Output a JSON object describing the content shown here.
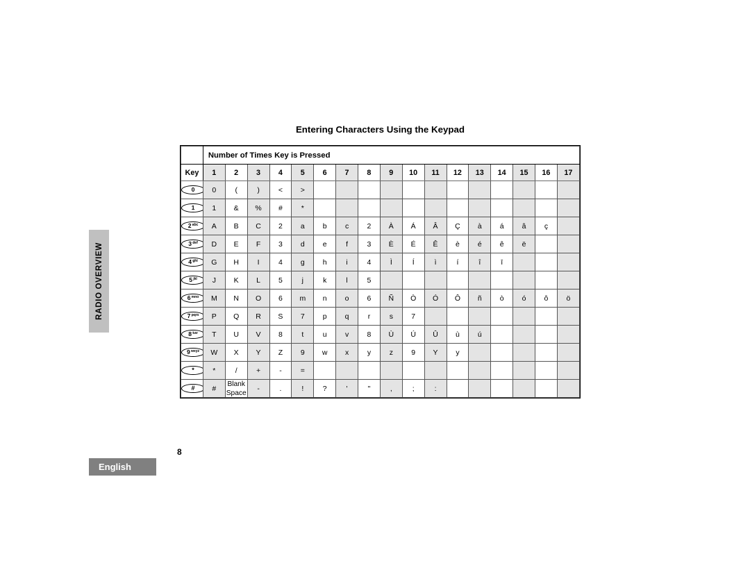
{
  "side_tab": {
    "label": "RADIO OVERVIEW"
  },
  "footer": {
    "language": "English",
    "page_number": "8"
  },
  "title": "Entering Characters Using the Keypad",
  "table": {
    "banner_label": "Number of Times Key is Pressed",
    "key_column_header": "Key",
    "press_headers": [
      "1",
      "2",
      "3",
      "4",
      "5",
      "6",
      "7",
      "8",
      "9",
      "10",
      "11",
      "12",
      "13",
      "14",
      "15",
      "16",
      "17"
    ],
    "rows": [
      {
        "key": {
          "number": "0",
          "letters": "",
          "type": "digit"
        },
        "cells": [
          "0",
          "(",
          ")",
          "<",
          ">",
          "",
          "",
          "",
          "",
          "",
          "",
          "",
          "",
          "",
          "",
          "",
          ""
        ]
      },
      {
        "key": {
          "number": "1",
          "letters": "",
          "type": "digit"
        },
        "cells": [
          "1",
          "&",
          "%",
          "#",
          "*",
          "",
          "",
          "",
          "",
          "",
          "",
          "",
          "",
          "",
          "",
          "",
          ""
        ]
      },
      {
        "key": {
          "number": "2",
          "letters": "abc",
          "type": "digit"
        },
        "cells": [
          "A",
          "B",
          "C",
          "2",
          "a",
          "b",
          "c",
          "2",
          "À",
          "Á",
          "Â",
          "Ç",
          "à",
          "á",
          "â",
          "ç",
          ""
        ]
      },
      {
        "key": {
          "number": "3",
          "letters": "def",
          "type": "digit"
        },
        "cells": [
          "D",
          "E",
          "F",
          "3",
          "d",
          "e",
          "f",
          "3",
          "È",
          "É",
          "Ê",
          "è",
          "é",
          "ê",
          "ë",
          "",
          ""
        ]
      },
      {
        "key": {
          "number": "4",
          "letters": "ghi",
          "type": "digit"
        },
        "cells": [
          "G",
          "H",
          "I",
          "4",
          "g",
          "h",
          "i",
          "4",
          "Ì",
          "Í",
          "ì",
          "í",
          "î",
          "ī",
          "",
          "",
          ""
        ]
      },
      {
        "key": {
          "number": "5",
          "letters": "jkl",
          "type": "digit"
        },
        "cells": [
          "J",
          "K",
          "L",
          "5",
          "j",
          "k",
          "l",
          "5",
          "",
          "",
          "",
          "",
          "",
          "",
          "",
          "",
          ""
        ]
      },
      {
        "key": {
          "number": "6",
          "letters": "mno",
          "type": "digit"
        },
        "cells": [
          "M",
          "N",
          "O",
          "6",
          "m",
          "n",
          "o",
          "6",
          "Ñ",
          "Ò",
          "Ó",
          "Ô",
          "ñ",
          "ò",
          "ó",
          "ô",
          "ö"
        ]
      },
      {
        "key": {
          "number": "7",
          "letters": "pqrs",
          "type": "digit"
        },
        "cells": [
          "P",
          "Q",
          "R",
          "S",
          "7",
          "p",
          "q",
          "r",
          "s",
          "7",
          "",
          "",
          "",
          "",
          "",
          "",
          ""
        ]
      },
      {
        "key": {
          "number": "8",
          "letters": "tuv",
          "type": "digit"
        },
        "cells": [
          "T",
          "U",
          "V",
          "8",
          "t",
          "u",
          "v",
          "8",
          "Ù",
          "Ú",
          "Û",
          "ù",
          "ú",
          "",
          "",
          "",
          ""
        ]
      },
      {
        "key": {
          "number": "9",
          "letters": "wxyz",
          "type": "digit"
        },
        "cells": [
          "W",
          "X",
          "Y",
          "Z",
          "9",
          "w",
          "x",
          "y",
          "z",
          "9",
          "Y",
          "y",
          "",
          "",
          "",
          "",
          ""
        ]
      },
      {
        "key": {
          "number": "*",
          "letters": "",
          "type": "symbol"
        },
        "cells": [
          "*",
          "/",
          "+",
          "-",
          "=",
          "",
          "",
          "",
          "",
          "",
          "",
          "",
          "",
          "",
          "",
          "",
          ""
        ]
      },
      {
        "key": {
          "number": "#",
          "letters": "",
          "type": "symbol"
        },
        "cells": [
          "#",
          "Blank\nSpace",
          "-",
          ".",
          "!",
          "?",
          "'",
          "\"",
          ",",
          ";",
          ":",
          "",
          "",
          "",
          "",
          "",
          ""
        ]
      }
    ]
  }
}
